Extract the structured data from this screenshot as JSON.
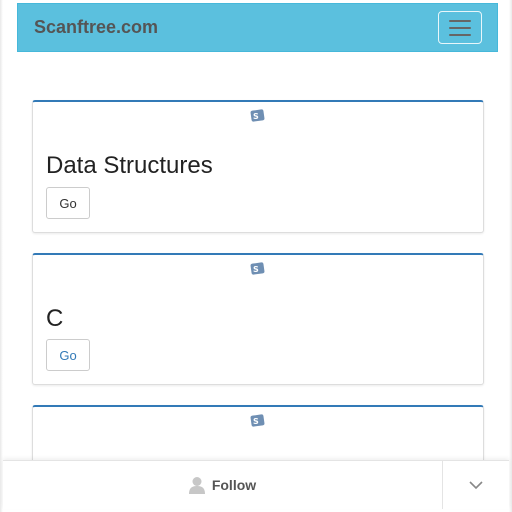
{
  "navbar": {
    "brand": "Scanftree.com",
    "toggle_icon": "hamburger-menu-icon",
    "background_color": "#5bc0de"
  },
  "cards": [
    {
      "title": "Data Structures",
      "button_label": "Go",
      "logo_icon": "scanftree-logo-icon"
    },
    {
      "title": "C",
      "button_label": "Go",
      "logo_icon": "scanftree-logo-icon"
    },
    {
      "title": "",
      "button_label": "",
      "logo_icon": "scanftree-logo-icon"
    }
  ],
  "footer": {
    "follow_label": "Follow",
    "follow_icon": "user-icon",
    "expand_icon": "chevron-down-icon"
  },
  "colors": {
    "accent": "#337ab7",
    "button_text": "#333333",
    "button_text_active": "#337ab7"
  }
}
